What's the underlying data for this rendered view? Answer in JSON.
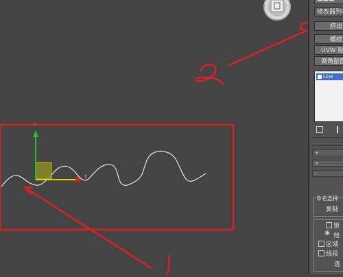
{
  "panel": {
    "top_partial": "▬▬▬",
    "modifier_list": "修改器列表",
    "buttons": [
      "挤出",
      "螺纹",
      "UVW 贴图",
      "倒角剖面"
    ],
    "stack_item": "Line",
    "named_selection": "命名选择",
    "copy_btn": "复制",
    "opt_1": "锁",
    "opt_2": "他",
    "opt_3": "区域",
    "opt_4": "线段",
    "sel_btn": "选"
  },
  "annotations": {
    "label_1": "1",
    "label_2": "2"
  },
  "colors": {
    "annotation": "#e02020",
    "spline": "#e6e6e6",
    "gizmo_y": "#22c022",
    "gizmo_x": "#e02020",
    "gizmo_plane": "#d8d800"
  }
}
